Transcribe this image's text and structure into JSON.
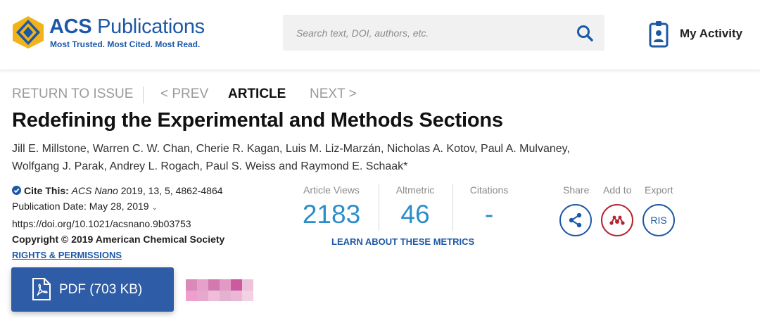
{
  "header": {
    "logo": {
      "name_bold": "ACS",
      "name_rest": "Publications",
      "tagline": "Most Trusted. Most Cited. Most Read."
    },
    "search": {
      "placeholder": "Search text, DOI, authors, etc.",
      "value": "",
      "icon": "search-icon"
    },
    "my_activity": {
      "label": "My Activity",
      "icon": "id-badge-icon"
    }
  },
  "article_nav": {
    "return": "RETURN TO ISSUE",
    "prev": "< PREV",
    "current": "ARTICLE",
    "next": "NEXT >"
  },
  "article": {
    "title": "Redefining the Experimental and Methods Sections",
    "authors_line1": "Jill E. Millstone, Warren C. W. Chan, Cherie R. Kagan, Luis M. Liz-Marzán, Nicholas A. Kotov, Paul A. Mulvaney,",
    "authors_line2": "Wolfgang J. Parak, Andrey L. Rogach, Paul S. Weiss and Raymond E. Schaak*"
  },
  "citation": {
    "cite_label": "Cite This:",
    "journal": "ACS Nano",
    "reference": "2019, 13, 5, 4862-4864",
    "pub_date_label": "Publication Date:",
    "pub_date": "May 28, 2019",
    "doi": "https://doi.org/10.1021/acsnano.9b03753",
    "copyright": "Copyright © 2019 American Chemical Society",
    "rights": "RIGHTS & PERMISSIONS"
  },
  "metrics": {
    "views": {
      "label": "Article Views",
      "value": "2183"
    },
    "altmetric": {
      "label": "Altmetric",
      "value": "46"
    },
    "citations": {
      "label": "Citations",
      "value": "-"
    },
    "learn_more": "LEARN ABOUT THESE METRICS"
  },
  "actions": {
    "share": {
      "label": "Share",
      "icon": "share-icon"
    },
    "add_to": {
      "label": "Add to",
      "icon": "mendeley-icon"
    },
    "export": {
      "label": "Export",
      "button_text": "RIS"
    }
  },
  "pdf": {
    "label": "PDF (703 KB)",
    "icon": "pdf-file-icon"
  },
  "colors": {
    "brand_blue": "#1d58a7",
    "metric_blue": "#2a8ec9",
    "pdf_button": "#2f5ca6",
    "mendeley_red": "#b5232f",
    "logo_gold": "#f2b31a"
  }
}
